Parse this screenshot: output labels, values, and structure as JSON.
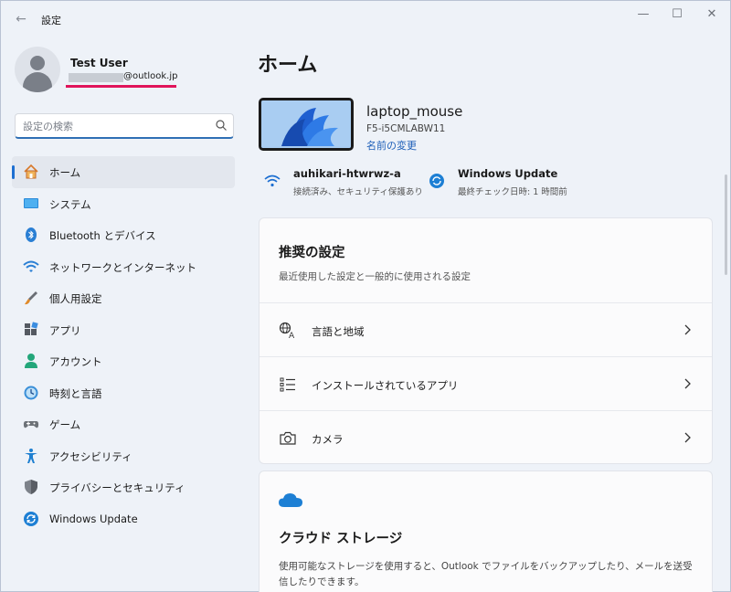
{
  "window": {
    "title": "設定",
    "controls": {
      "minimize": "—",
      "maximize": "☐",
      "close": "✕"
    },
    "back_glyph": "←"
  },
  "profile": {
    "name": "Test User",
    "email_domain": "@outlook.jp"
  },
  "search": {
    "placeholder": "設定の検索",
    "value": ""
  },
  "sidebar": {
    "items": [
      {
        "label": "ホーム",
        "icon": "home-icon",
        "active": true
      },
      {
        "label": "システム",
        "icon": "system-icon"
      },
      {
        "label": "Bluetooth とデバイス",
        "icon": "bluetooth-icon"
      },
      {
        "label": "ネットワークとインターネット",
        "icon": "wifi-icon"
      },
      {
        "label": "個人用設定",
        "icon": "brush-icon"
      },
      {
        "label": "アプリ",
        "icon": "apps-icon"
      },
      {
        "label": "アカウント",
        "icon": "account-icon"
      },
      {
        "label": "時刻と言語",
        "icon": "time-language-icon"
      },
      {
        "label": "ゲーム",
        "icon": "gamepad-icon"
      },
      {
        "label": "アクセシビリティ",
        "icon": "accessibility-icon"
      },
      {
        "label": "プライバシーとセキュリティ",
        "icon": "shield-icon"
      },
      {
        "label": "Windows Update",
        "icon": "update-icon"
      }
    ]
  },
  "main": {
    "title": "ホーム",
    "device": {
      "name": "laptop_mouse",
      "model": "F5-i5CMLABW11",
      "rename_link": "名前の変更"
    },
    "status": {
      "network": {
        "title": "auhikari-htwrwz-a",
        "subtitle": "接続済み、セキュリティ保護あり"
      },
      "update": {
        "title": "Windows Update",
        "subtitle": "最終チェック日時: 1 時間前"
      }
    },
    "recommended": {
      "title": "推奨の設定",
      "subtitle": "最近使用した設定と一般的に使用される設定",
      "rows": [
        {
          "label": "言語と地域",
          "icon": "language-icon"
        },
        {
          "label": "インストールされているアプリ",
          "icon": "list-icon"
        },
        {
          "label": "カメラ",
          "icon": "camera-icon"
        }
      ]
    },
    "cloud": {
      "title": "クラウド ストレージ",
      "description": "使用可能なストレージを使用すると、Outlook でファイルをバックアップしたり、メールを送受信したりできます。",
      "icon": "cloud-icon"
    }
  },
  "colors": {
    "accent": "#1d6fd1",
    "email_underline": "#e0145a",
    "link": "#1d5fb8"
  }
}
